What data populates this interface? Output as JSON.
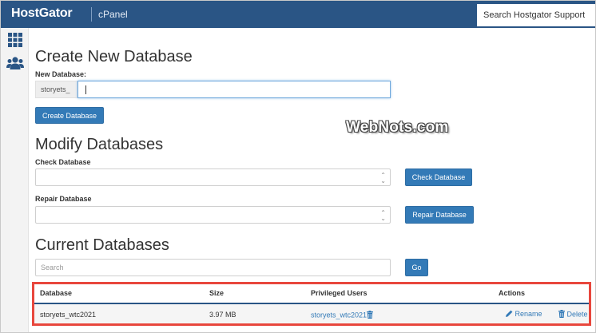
{
  "header": {
    "brand": "HostGator",
    "product": "cPanel",
    "search_placeholder": "Search Hostgator Support"
  },
  "sidebar": {
    "icons": [
      "grid-icon",
      "users-icon"
    ]
  },
  "create": {
    "title": "Create New Database",
    "label": "New Database:",
    "prefix": "storyets_",
    "value": "",
    "button": "Create Database"
  },
  "modify": {
    "title": "Modify Databases",
    "check_label": "Check Database",
    "check_value": "",
    "check_button": "Check Database",
    "repair_label": "Repair Database",
    "repair_value": "",
    "repair_button": "Repair Database"
  },
  "current": {
    "title": "Current Databases",
    "search_placeholder": "Search",
    "go_button": "Go",
    "columns": [
      "Database",
      "Size",
      "Privileged Users",
      "Actions"
    ],
    "rows": [
      {
        "database": "storyets_wtc2021",
        "size": "3.97 MB",
        "user": "storyets_wtc2021",
        "rename": "Rename",
        "delete": "Delete"
      }
    ]
  },
  "watermark": "WebNots.com",
  "colors": {
    "header_bg": "#2a5585",
    "button_bg": "#337ab7",
    "highlight_border": "#e8473d"
  }
}
